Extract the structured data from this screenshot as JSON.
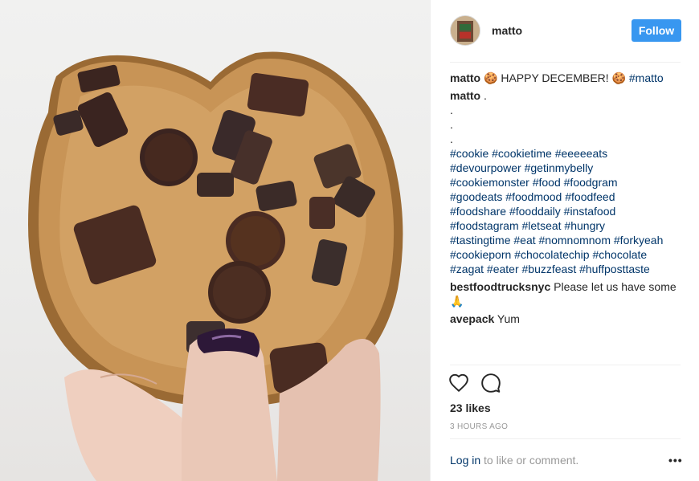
{
  "post": {
    "username": "matto",
    "follow_label": "Follow",
    "caption_user": "matto",
    "caption_text": " 🍪 HAPPY DECEMBER! 🍪 ",
    "caption_tag": "#matto",
    "second_user": "matto",
    "second_text": " .",
    "dots": [
      ".",
      ".",
      "."
    ],
    "hashtag_lines": [
      "#cookie #cookietime #eeeeeats",
      "#devourpower #getinmybelly",
      "#cookiemonster #food #foodgram",
      "#goodeats #foodmood #foodfeed",
      "#foodshare #fooddaily #instafood",
      "#foodstagram #letseat #hungry",
      "#tastingtime #eat #nomnomnom #forkyeah",
      "#cookieporn #chocolatechip #chocolate",
      "#zagat #eater #buzzfeast #huffposttaste"
    ],
    "comments": [
      {
        "user": "bestfoodtrucksnyc",
        "text": " Please let us have some 🙏"
      },
      {
        "user": "avepack",
        "text": " Yum"
      }
    ],
    "likes": "23 likes",
    "time": "3 HOURS AGO",
    "login_link": "Log in",
    "login_rest": " to like or comment.",
    "more": "•••"
  },
  "icons": {
    "like": "heart-icon",
    "comment": "comment-icon",
    "more": "more-options-icon"
  },
  "colors": {
    "follow_bg": "#3897f0",
    "hashtag": "#003569",
    "muted": "#999999"
  }
}
